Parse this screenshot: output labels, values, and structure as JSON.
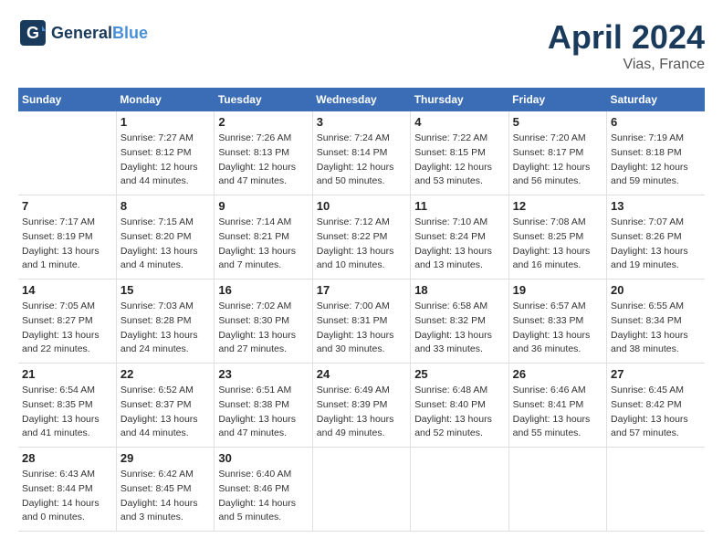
{
  "header": {
    "logo_general": "General",
    "logo_blue": "Blue",
    "title": "April 2024",
    "subtitle": "Vias, France"
  },
  "columns": [
    "Sunday",
    "Monday",
    "Tuesday",
    "Wednesday",
    "Thursday",
    "Friday",
    "Saturday"
  ],
  "weeks": [
    [
      {
        "day": "",
        "info": ""
      },
      {
        "day": "1",
        "info": "Sunrise: 7:27 AM\nSunset: 8:12 PM\nDaylight: 12 hours\nand 44 minutes."
      },
      {
        "day": "2",
        "info": "Sunrise: 7:26 AM\nSunset: 8:13 PM\nDaylight: 12 hours\nand 47 minutes."
      },
      {
        "day": "3",
        "info": "Sunrise: 7:24 AM\nSunset: 8:14 PM\nDaylight: 12 hours\nand 50 minutes."
      },
      {
        "day": "4",
        "info": "Sunrise: 7:22 AM\nSunset: 8:15 PM\nDaylight: 12 hours\nand 53 minutes."
      },
      {
        "day": "5",
        "info": "Sunrise: 7:20 AM\nSunset: 8:17 PM\nDaylight: 12 hours\nand 56 minutes."
      },
      {
        "day": "6",
        "info": "Sunrise: 7:19 AM\nSunset: 8:18 PM\nDaylight: 12 hours\nand 59 minutes."
      }
    ],
    [
      {
        "day": "7",
        "info": "Sunrise: 7:17 AM\nSunset: 8:19 PM\nDaylight: 13 hours\nand 1 minute."
      },
      {
        "day": "8",
        "info": "Sunrise: 7:15 AM\nSunset: 8:20 PM\nDaylight: 13 hours\nand 4 minutes."
      },
      {
        "day": "9",
        "info": "Sunrise: 7:14 AM\nSunset: 8:21 PM\nDaylight: 13 hours\nand 7 minutes."
      },
      {
        "day": "10",
        "info": "Sunrise: 7:12 AM\nSunset: 8:22 PM\nDaylight: 13 hours\nand 10 minutes."
      },
      {
        "day": "11",
        "info": "Sunrise: 7:10 AM\nSunset: 8:24 PM\nDaylight: 13 hours\nand 13 minutes."
      },
      {
        "day": "12",
        "info": "Sunrise: 7:08 AM\nSunset: 8:25 PM\nDaylight: 13 hours\nand 16 minutes."
      },
      {
        "day": "13",
        "info": "Sunrise: 7:07 AM\nSunset: 8:26 PM\nDaylight: 13 hours\nand 19 minutes."
      }
    ],
    [
      {
        "day": "14",
        "info": "Sunrise: 7:05 AM\nSunset: 8:27 PM\nDaylight: 13 hours\nand 22 minutes."
      },
      {
        "day": "15",
        "info": "Sunrise: 7:03 AM\nSunset: 8:28 PM\nDaylight: 13 hours\nand 24 minutes."
      },
      {
        "day": "16",
        "info": "Sunrise: 7:02 AM\nSunset: 8:30 PM\nDaylight: 13 hours\nand 27 minutes."
      },
      {
        "day": "17",
        "info": "Sunrise: 7:00 AM\nSunset: 8:31 PM\nDaylight: 13 hours\nand 30 minutes."
      },
      {
        "day": "18",
        "info": "Sunrise: 6:58 AM\nSunset: 8:32 PM\nDaylight: 13 hours\nand 33 minutes."
      },
      {
        "day": "19",
        "info": "Sunrise: 6:57 AM\nSunset: 8:33 PM\nDaylight: 13 hours\nand 36 minutes."
      },
      {
        "day": "20",
        "info": "Sunrise: 6:55 AM\nSunset: 8:34 PM\nDaylight: 13 hours\nand 38 minutes."
      }
    ],
    [
      {
        "day": "21",
        "info": "Sunrise: 6:54 AM\nSunset: 8:35 PM\nDaylight: 13 hours\nand 41 minutes."
      },
      {
        "day": "22",
        "info": "Sunrise: 6:52 AM\nSunset: 8:37 PM\nDaylight: 13 hours\nand 44 minutes."
      },
      {
        "day": "23",
        "info": "Sunrise: 6:51 AM\nSunset: 8:38 PM\nDaylight: 13 hours\nand 47 minutes."
      },
      {
        "day": "24",
        "info": "Sunrise: 6:49 AM\nSunset: 8:39 PM\nDaylight: 13 hours\nand 49 minutes."
      },
      {
        "day": "25",
        "info": "Sunrise: 6:48 AM\nSunset: 8:40 PM\nDaylight: 13 hours\nand 52 minutes."
      },
      {
        "day": "26",
        "info": "Sunrise: 6:46 AM\nSunset: 8:41 PM\nDaylight: 13 hours\nand 55 minutes."
      },
      {
        "day": "27",
        "info": "Sunrise: 6:45 AM\nSunset: 8:42 PM\nDaylight: 13 hours\nand 57 minutes."
      }
    ],
    [
      {
        "day": "28",
        "info": "Sunrise: 6:43 AM\nSunset: 8:44 PM\nDaylight: 14 hours\nand 0 minutes."
      },
      {
        "day": "29",
        "info": "Sunrise: 6:42 AM\nSunset: 8:45 PM\nDaylight: 14 hours\nand 3 minutes."
      },
      {
        "day": "30",
        "info": "Sunrise: 6:40 AM\nSunset: 8:46 PM\nDaylight: 14 hours\nand 5 minutes."
      },
      {
        "day": "",
        "info": ""
      },
      {
        "day": "",
        "info": ""
      },
      {
        "day": "",
        "info": ""
      },
      {
        "day": "",
        "info": ""
      }
    ]
  ]
}
